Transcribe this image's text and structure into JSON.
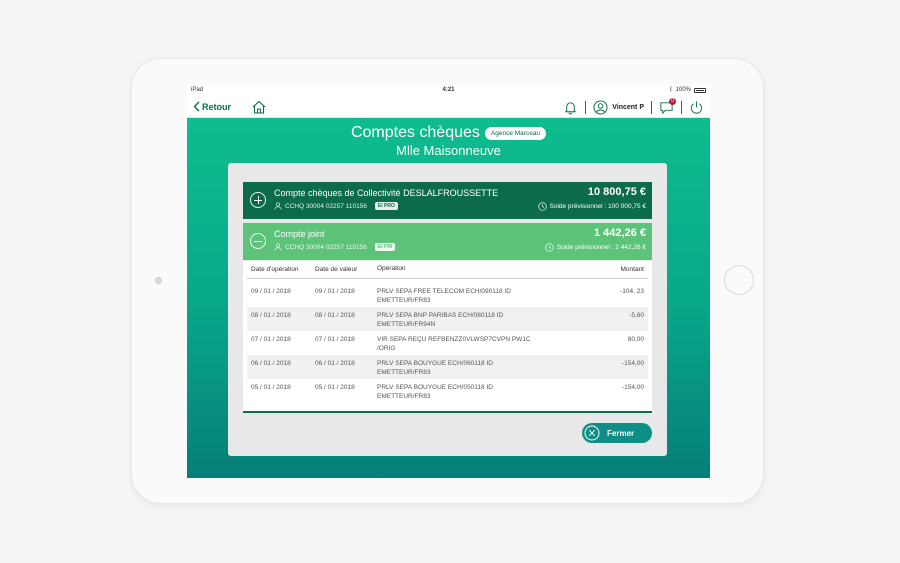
{
  "device": {
    "carrier": "iPad",
    "time": "4:21",
    "battery": "100%"
  },
  "navbar": {
    "back_label": "Retour",
    "user_name": "Vincent P",
    "messages_count": "0"
  },
  "header": {
    "title": "Comptes chèques",
    "agency": "Agence Marceau",
    "customer": "Mlle Maisonneuve"
  },
  "accounts": [
    {
      "name": "Compte chèques de Collectivité DESLALFROUSSETTE",
      "number": "CCHQ 30004 02257 110156",
      "tag": "EI PRO",
      "amount": "10 800,75 €",
      "forecast": "Solde prévisionnel : 100 000,75 €"
    },
    {
      "name": "Compte joint",
      "number": "CCHQ 30004 02257 110156",
      "tag": "EI PRI",
      "amount": "1 442,26 €",
      "forecast": "Solde prévisionnel : 2 442,26 €"
    }
  ],
  "table": {
    "headers": [
      "Date d'opération",
      "Date de valeur",
      "Opération",
      "Montant"
    ],
    "rows": [
      {
        "op_date": "09 / 01 / 2018",
        "value_date": "09 / 01 / 2018",
        "operation": "PRLV SEPA FREE TELECOM ECH/090118 ID EMETTEUR/FR83",
        "amount": "-104, 23"
      },
      {
        "op_date": "08 / 01 / 2018",
        "value_date": "08 / 01 / 2018",
        "operation": "PRLV SEPA BNP PARIBAS ECH/080118 ID EMETTEUR/FR94N",
        "amount": "-5,60"
      },
      {
        "op_date": "07 / 01 / 2018",
        "value_date": "07 / 01 / 2018",
        "operation": "VIR SEPA REÇU REFBENZZ0VLWSP7CVPN PW1C /ORIG",
        "amount": "80,00"
      },
      {
        "op_date": "06 / 01 / 2018",
        "value_date": "06 / 01 / 2018",
        "operation": "PRLV SEPA BOUYGUE ECH/060118 ID EMETTEUR/FR83",
        "amount": "-154,00"
      },
      {
        "op_date": "05 / 01 / 2018",
        "value_date": "05 / 01 / 2018",
        "operation": "PRLV SEPA BOUYGUE ECH/050118 ID EMETTEUR/FR83",
        "amount": "-154,00"
      }
    ]
  },
  "close_label": "Fermer",
  "colors": {
    "dark_green": "#0b6b4a",
    "light_green": "#5dc378",
    "teal_button": "#0d8f85",
    "badge_red": "#b01e3c"
  }
}
